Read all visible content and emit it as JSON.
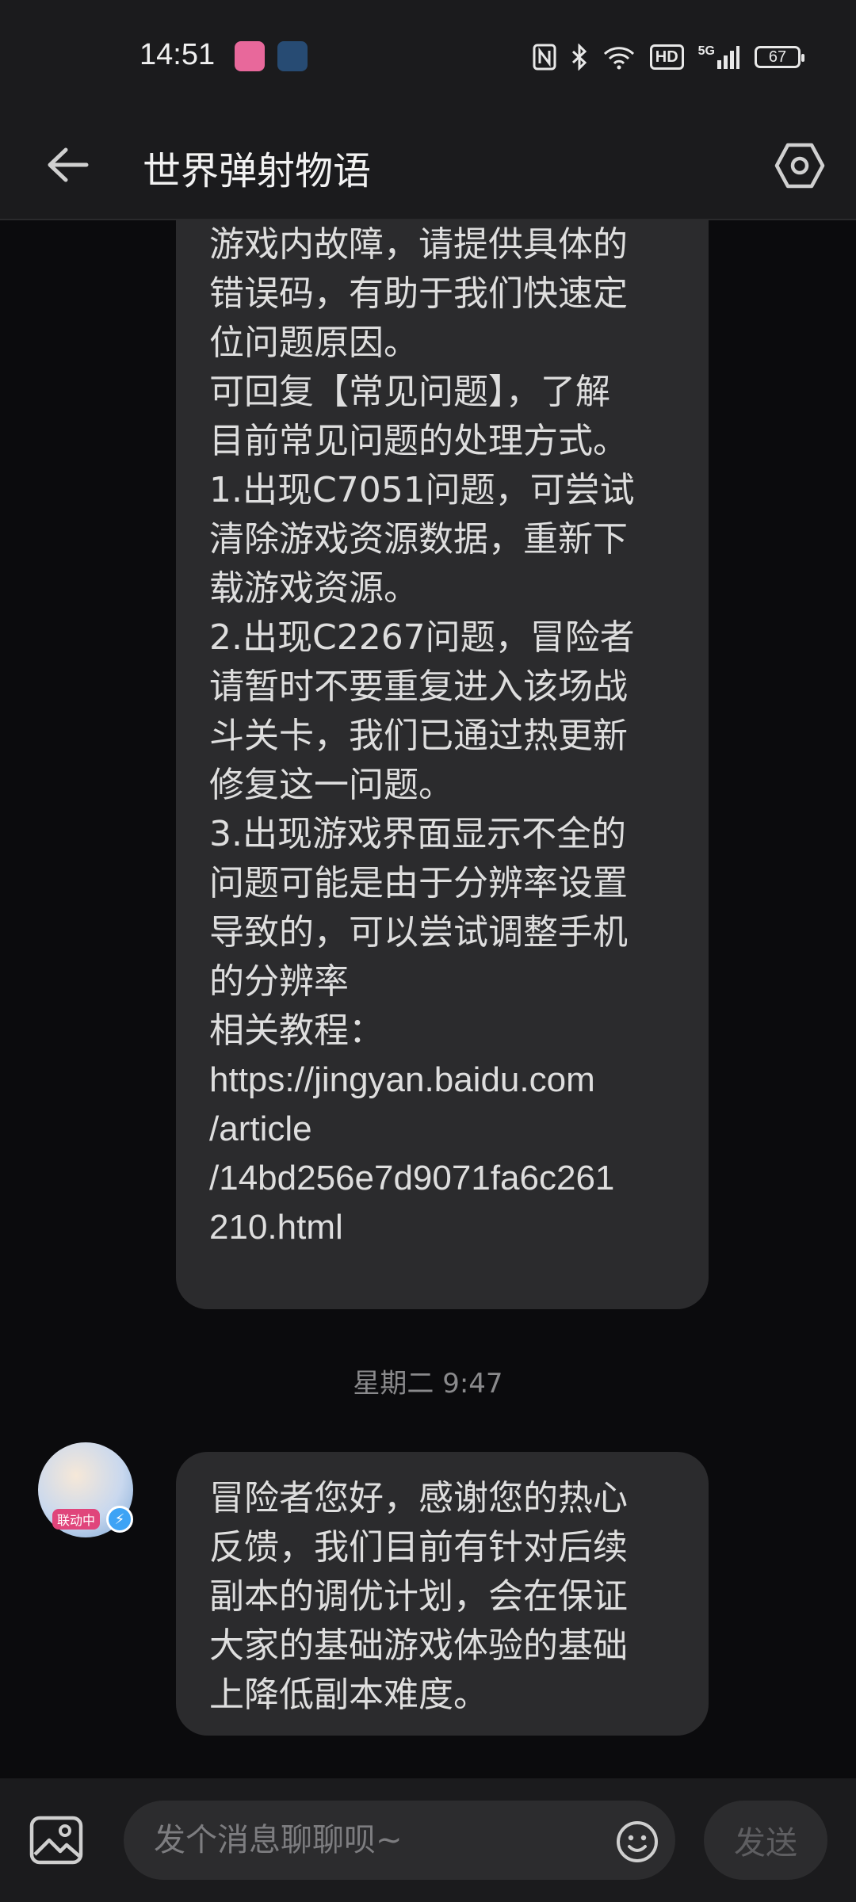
{
  "status_bar": {
    "time": "14:51",
    "nfc_icon": "nfc-icon",
    "bluetooth_icon": "bluetooth-icon",
    "wifi_icon": "wifi-icon",
    "hd_label": "HD",
    "network_label": "5G",
    "battery": "67"
  },
  "header": {
    "title": "世界弹射物语",
    "back_icon": "back-arrow-icon",
    "settings_icon": "settings-hexagon-icon"
  },
  "messages": [
    {
      "lines": [
        "游戏内故障，请提供具体的",
        "错误码，有助于我们快速定",
        "位问题原因。",
        "可回复【常见问题】，了解",
        "目前常见问题的处理方式。",
        "1.出现C7051问题，可尝试",
        "清除游戏资源数据，重新下",
        "载游戏资源。",
        "2.出现C2267问题，冒险者",
        "请暂时不要重复进入该场战",
        "斗关卡，我们已通过热更新",
        "修复这一问题。",
        "3.出现游戏界面显示不全的",
        "问题可能是由于分辨率设置",
        "导致的，可以尝试调整手机",
        "的分辨率",
        "相关教程：",
        "https://jingyan.baidu.com",
        "/article",
        "/14bd256e7d9071fa6c261",
        "210.html"
      ]
    },
    {
      "timestamp": "星期二 9:47",
      "avatar_tag": "联动中",
      "lines": [
        "冒险者您好，感谢您的热心",
        "反馈，我们目前有针对后续",
        "副本的调优计划，会在保证",
        "大家的基础游戏体验的基础",
        "上降低副本难度。"
      ]
    }
  ],
  "input_bar": {
    "placeholder": "发个消息聊聊呗~",
    "send_label": "发送",
    "image_icon": "image-icon",
    "emoji_icon": "emoji-icon"
  }
}
